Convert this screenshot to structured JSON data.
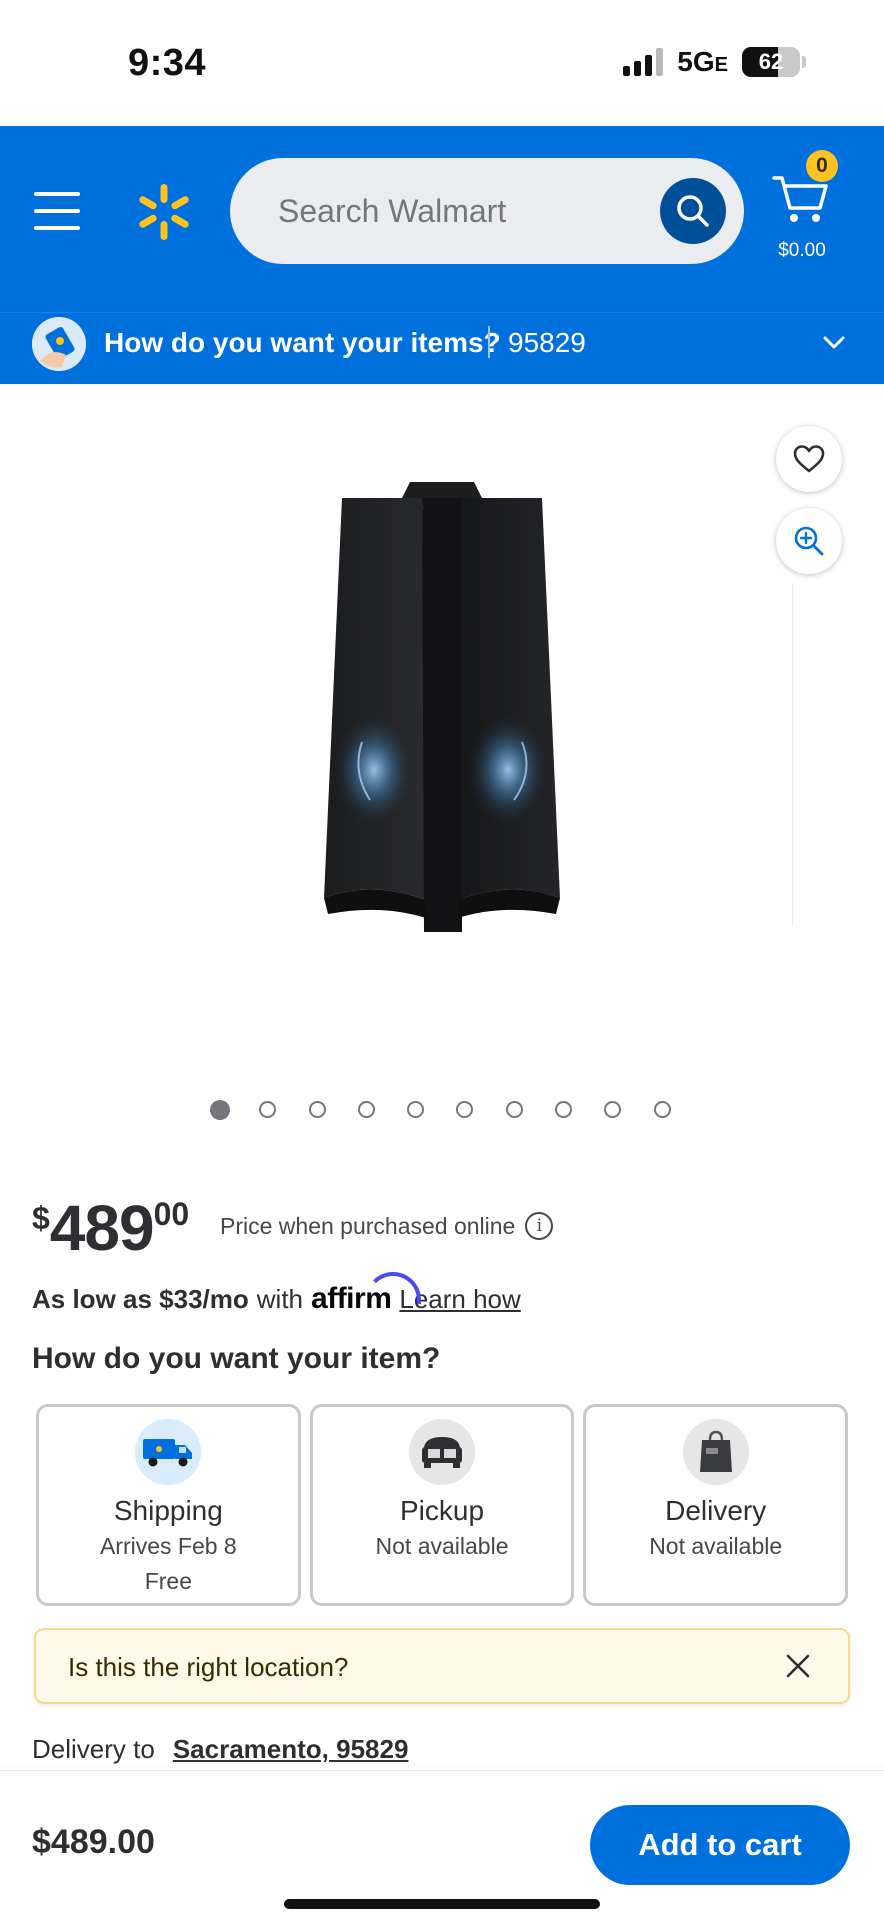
{
  "status": {
    "time": "9:34",
    "network": "5G",
    "network_suffix": "E",
    "battery": "62",
    "battery_level": 0.62
  },
  "header": {
    "search_placeholder": "Search Walmart",
    "cart_count": "0",
    "cart_total": "$0.00",
    "brand_color": "#0071dc",
    "spark_color": "#ffc220"
  },
  "location_bar": {
    "prompt": "How do you want your items?",
    "zip": "95829"
  },
  "gallery": {
    "image_count": 10,
    "active_index": 0
  },
  "price": {
    "currency": "$",
    "whole": "489",
    "cents": "00",
    "note": "Price when purchased online",
    "info_icon": "i"
  },
  "financing": {
    "prefix": "As low as $33/mo",
    "with": "with",
    "provider": "affirm",
    "link": "Learn how"
  },
  "fulfillment": {
    "title": "How do you want your item?",
    "options": [
      {
        "name": "Shipping",
        "line1": "Arrives Feb 8",
        "line2": "Free",
        "icon": "truck-icon"
      },
      {
        "name": "Pickup",
        "line1": "Not available",
        "icon": "car-trunk-icon"
      },
      {
        "name": "Delivery",
        "line1": "Not available",
        "icon": "bag-icon"
      }
    ]
  },
  "location_alert": {
    "text": "Is this the right location?"
  },
  "delivery": {
    "label": "Delivery to",
    "city": "Sacramento, 95829"
  },
  "bottom_bar": {
    "price": "$489.00",
    "button": "Add to cart"
  }
}
